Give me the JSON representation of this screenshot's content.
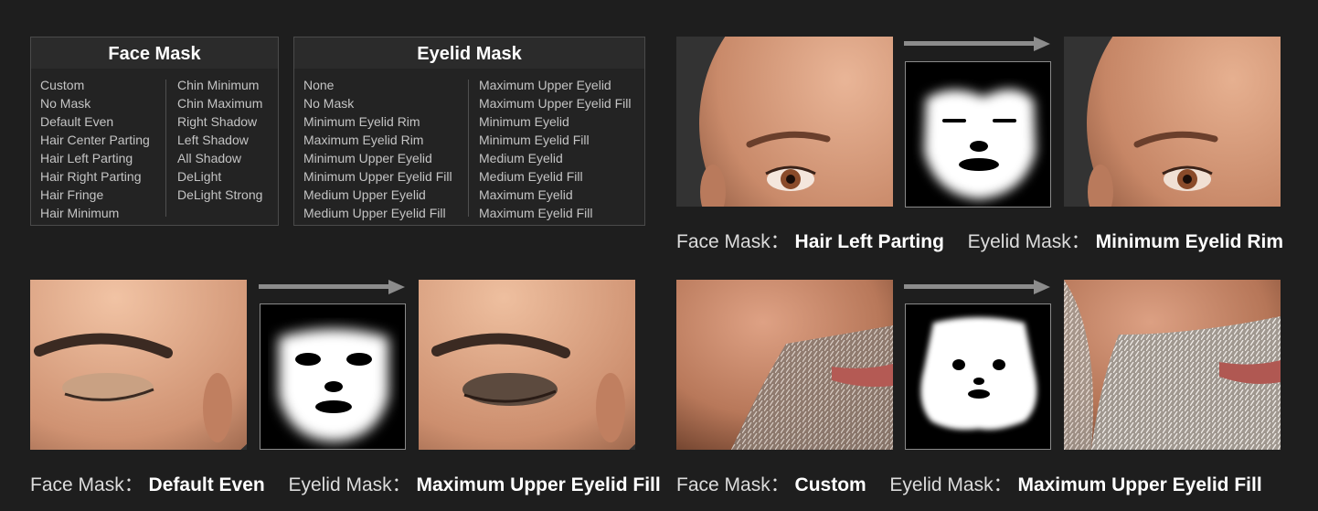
{
  "face_mask_panel": {
    "title": "Face Mask",
    "left_items": [
      "Custom",
      "No Mask",
      "Default Even",
      "Hair Center Parting",
      "Hair Left Parting",
      "Hair Right Parting",
      "Hair Fringe",
      "Hair Minimum"
    ],
    "right_items": [
      "Chin Minimum",
      "Chin Maximum",
      "Right Shadow",
      "Left Shadow",
      "All Shadow",
      "DeLight",
      "DeLight Strong"
    ]
  },
  "eyelid_mask_panel": {
    "title": "Eyelid Mask",
    "left_items": [
      "None",
      "No Mask",
      "Minimum Eyelid Rim",
      "Maximum Eyelid Rim",
      "Minimum Upper Eyelid",
      "Minimum Upper Eyelid Fill",
      "Medium Upper Eyelid",
      "Medium Upper Eyelid Fill"
    ],
    "right_items": [
      "Maximum Upper Eyelid",
      "Maximum Upper Eyelid Fill",
      "Minimum Eyelid",
      "Minimum Eyelid Fill",
      "Medium Eyelid",
      "Medium Eyelid Fill",
      "Maximum Eyelid",
      "Maximum Eyelid Fill"
    ]
  },
  "examples": [
    {
      "face_label": "Face Mask：",
      "face_value": "Hair Left Parting",
      "eyelid_label": "Eyelid Mask：",
      "eyelid_value": "Minimum Eyelid Rim"
    },
    {
      "face_label": "Face Mask：",
      "face_value": "Default Even",
      "eyelid_label": "Eyelid Mask：",
      "eyelid_value": "Maximum Upper Eyelid Fill"
    },
    {
      "face_label": "Face Mask：",
      "face_value": "Custom",
      "eyelid_label": "Eyelid Mask：",
      "eyelid_value": "Maximum Upper Eyelid Fill"
    }
  ],
  "colors": {
    "background": "#1e1e1e",
    "panel": "#232323",
    "panel_border": "#4a4a4a",
    "arrow": "#8c8c8c"
  }
}
